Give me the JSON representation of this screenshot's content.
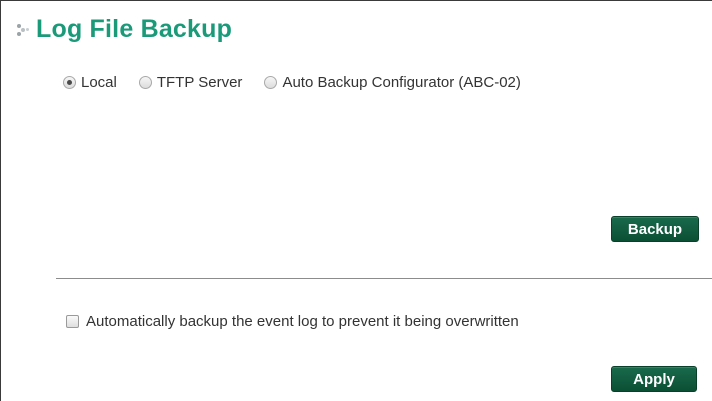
{
  "header": {
    "title": "Log File Backup",
    "icon": "dots-icon"
  },
  "destination": {
    "options": [
      {
        "label": "Local",
        "checked": true
      },
      {
        "label": "TFTP Server",
        "checked": false
      },
      {
        "label": "Auto Backup Configurator (ABC-02)",
        "checked": false
      }
    ]
  },
  "actions": {
    "backup_label": "Backup",
    "apply_label": "Apply"
  },
  "auto_backup": {
    "label": "Automatically backup the event log to prevent it being overwritten",
    "checked": false
  },
  "colors": {
    "title": "#1b9a7a",
    "button": "#0b4f35"
  }
}
